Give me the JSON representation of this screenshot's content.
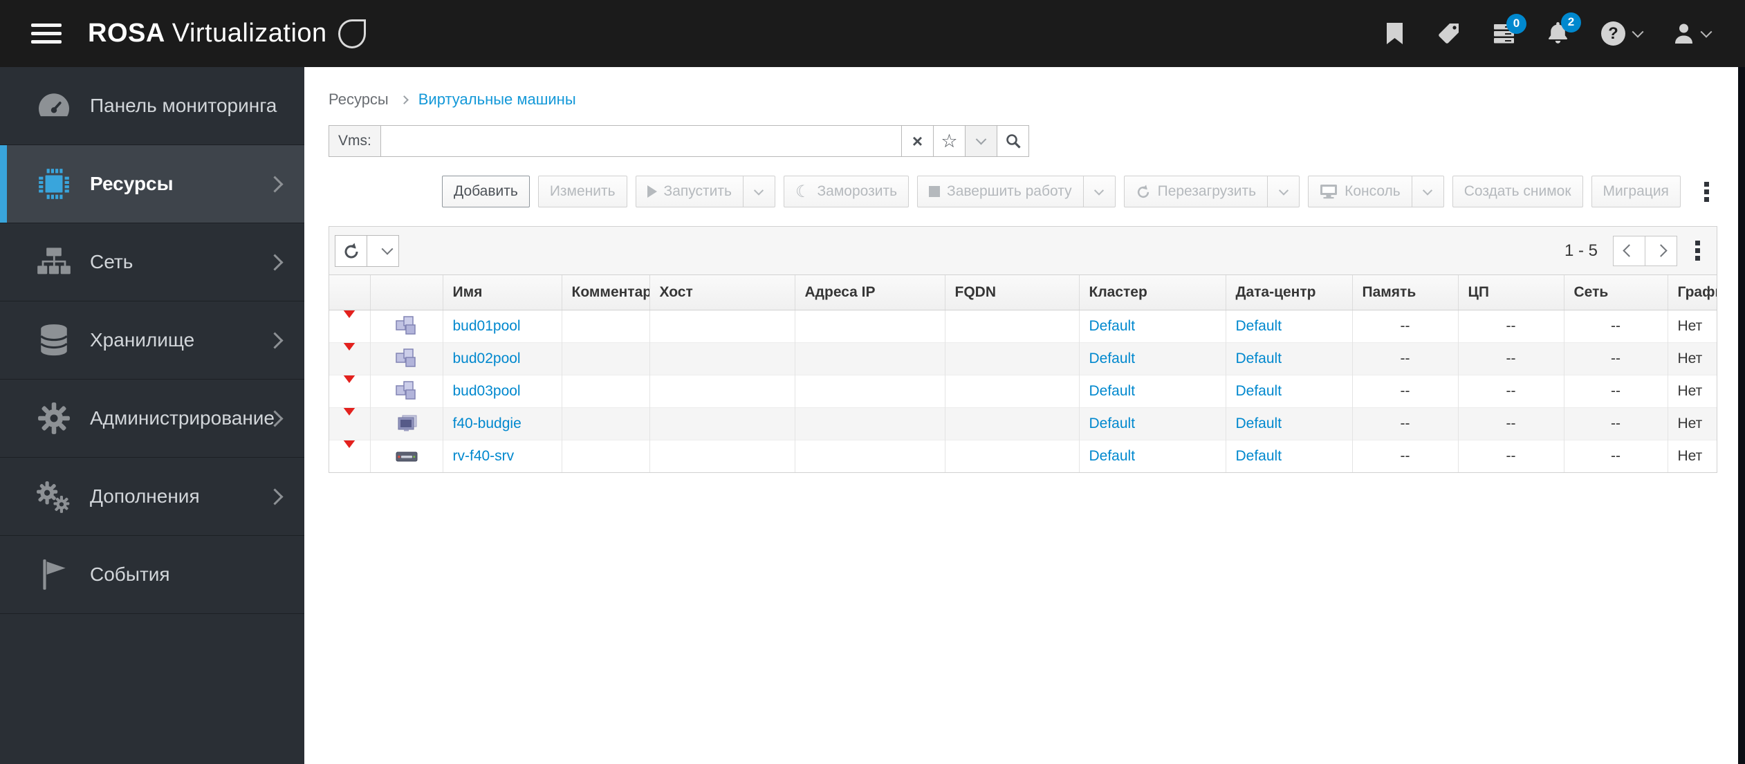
{
  "colors": {
    "accent_blue": "#39a5dc",
    "link_blue": "#0088ce",
    "breadcrumb_link": "#1398d8",
    "header_bg": "#1b1b1b",
    "sidebar_bg": "#2a2f35",
    "status_red": "#e3211e",
    "badge_blue": "#0088ce"
  },
  "header": {
    "brand_bold": "ROSA",
    "brand_rest": "Virtualization",
    "tasks_badge": "0",
    "alerts_badge": "2",
    "help_glyph": "?"
  },
  "sidebar": {
    "items": [
      {
        "label": "Панель мониторинга",
        "icon": "dashboard-gauge",
        "active": false,
        "has_chevron": false
      },
      {
        "label": "Ресурсы",
        "icon": "compute-chip",
        "active": true,
        "has_chevron": true
      },
      {
        "label": "Сеть",
        "icon": "network-sitemap",
        "active": false,
        "has_chevron": true
      },
      {
        "label": "Хранилище",
        "icon": "storage-database",
        "active": false,
        "has_chevron": true
      },
      {
        "label": "Администрирование",
        "icon": "administration-gear",
        "active": false,
        "has_chevron": true
      },
      {
        "label": "Дополнения",
        "icon": "addons-gears",
        "active": false,
        "has_chevron": true
      },
      {
        "label": "События",
        "icon": "events-flag",
        "active": false,
        "has_chevron": false
      }
    ]
  },
  "breadcrumb": {
    "parent": "Ресурсы",
    "current": "Виртуальные машины"
  },
  "search": {
    "label": "Vms:",
    "value": ""
  },
  "toolbar": {
    "add": "Добавить",
    "edit": "Изменить",
    "run": "Запустить",
    "suspend": "Заморозить",
    "shutdown": "Завершить работу",
    "reboot": "Перезагрузить",
    "console": "Консоль",
    "snapshot": "Создать снимок",
    "migrate": "Миграция"
  },
  "grid": {
    "pagination": "1 - 5",
    "columns": [
      "",
      "",
      "Имя",
      "Комментарий",
      "Хост",
      "Адреса IP",
      "FQDN",
      "Кластер",
      "Дата-центр",
      "Память",
      "ЦП",
      "Сеть",
      "Графика"
    ],
    "rows": [
      {
        "status": "down",
        "type": "pool",
        "name": "bud01pool",
        "comment": "",
        "host": "",
        "ip": "",
        "fqdn": "",
        "cluster": "Default",
        "datacenter": "Default",
        "memory": "--",
        "cpu": "--",
        "network": "--",
        "graphics": "Нет"
      },
      {
        "status": "down",
        "type": "pool",
        "name": "bud02pool",
        "comment": "",
        "host": "",
        "ip": "",
        "fqdn": "",
        "cluster": "Default",
        "datacenter": "Default",
        "memory": "--",
        "cpu": "--",
        "network": "--",
        "graphics": "Нет"
      },
      {
        "status": "down",
        "type": "pool",
        "name": "bud03pool",
        "comment": "",
        "host": "",
        "ip": "",
        "fqdn": "",
        "cluster": "Default",
        "datacenter": "Default",
        "memory": "--",
        "cpu": "--",
        "network": "--",
        "graphics": "Нет"
      },
      {
        "status": "down",
        "type": "desktop",
        "name": "f40-budgie",
        "comment": "",
        "host": "",
        "ip": "",
        "fqdn": "",
        "cluster": "Default",
        "datacenter": "Default",
        "memory": "--",
        "cpu": "--",
        "network": "--",
        "graphics": "Нет"
      },
      {
        "status": "down",
        "type": "server",
        "name": "rv-f40-srv",
        "comment": "",
        "host": "",
        "ip": "",
        "fqdn": "",
        "cluster": "Default",
        "datacenter": "Default",
        "memory": "--",
        "cpu": "--",
        "network": "--",
        "graphics": "Нет"
      }
    ]
  }
}
